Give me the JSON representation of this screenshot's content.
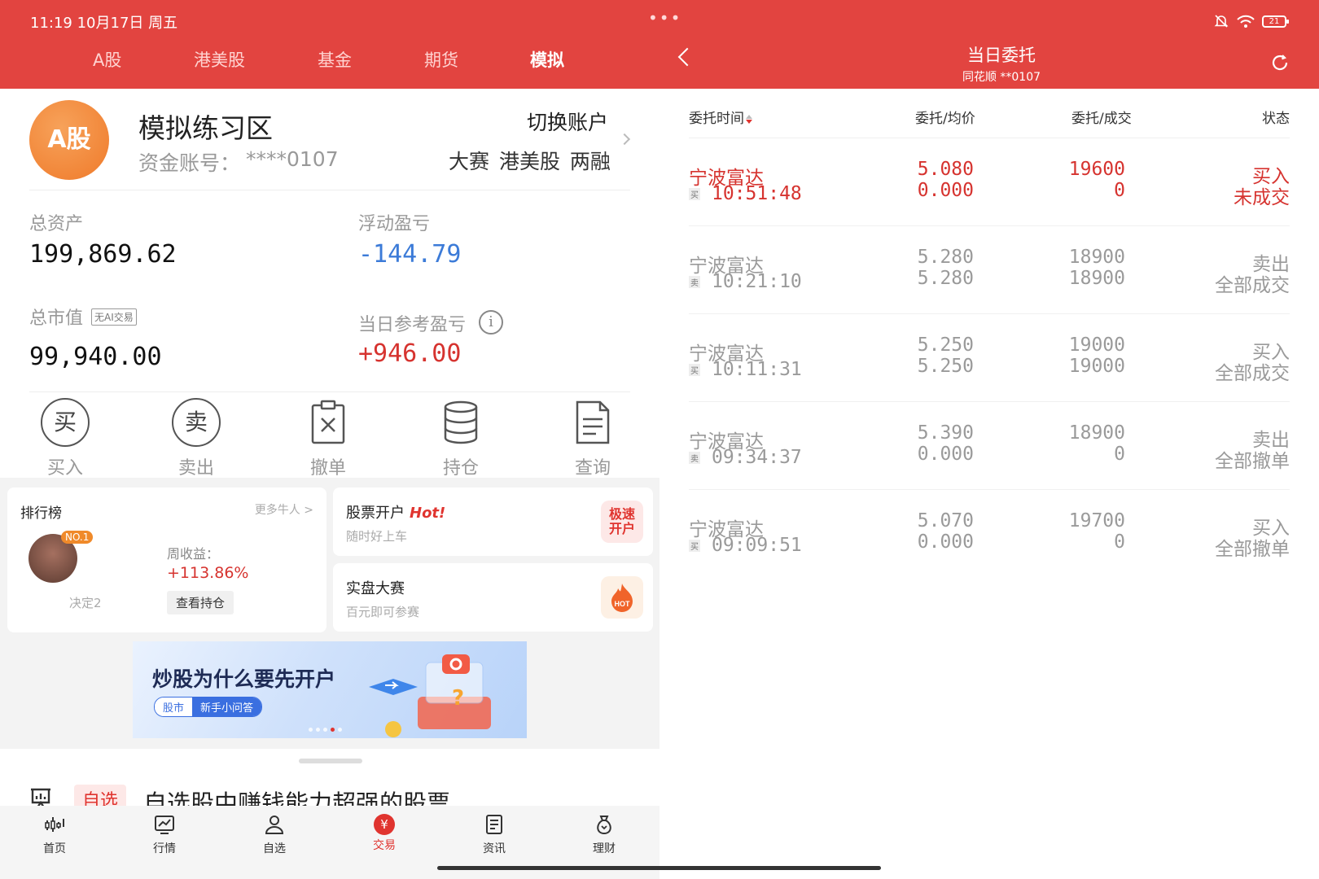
{
  "status": {
    "time": "11:19  10月17日 周五",
    "dots": "•••",
    "battery": "21"
  },
  "market_tabs": [
    {
      "label": "A股"
    },
    {
      "label": "港美股"
    },
    {
      "label": "基金"
    },
    {
      "label": "期货"
    },
    {
      "label": "模拟",
      "active": true
    }
  ],
  "account": {
    "avatar": "A股",
    "title": "模拟练习区",
    "account_no_label": "资金账号：",
    "account_no": "****0107",
    "switch_label": "切换账户",
    "links": "大赛 港美股 两融"
  },
  "stats": {
    "total_assets_label": "总资产",
    "total_assets": "199,869.62",
    "floating_pl_label": "浮动盈亏",
    "floating_pl": "-144.79",
    "market_value_label": "总市值",
    "ai_badge": "无AI交易",
    "market_value": "99,940.00",
    "daily_pl_label": "当日参考盈亏",
    "daily_pl": "+946.00"
  },
  "actions": [
    {
      "label": "买入",
      "glyph": "买",
      "icon": "buy-icon"
    },
    {
      "label": "卖出",
      "glyph": "卖",
      "icon": "sell-icon"
    },
    {
      "label": "撤单",
      "icon": "cancel-order-icon"
    },
    {
      "label": "持仓",
      "icon": "holdings-icon"
    },
    {
      "label": "查询",
      "icon": "query-icon"
    }
  ],
  "ranking": {
    "title": "排行榜",
    "more": "更多牛人 >",
    "badge": "NO.1",
    "name": "决定2",
    "weekly_label": "周收益：",
    "weekly_value": "+113.86%",
    "button": "查看持仓"
  },
  "promos": [
    {
      "title": "股票开户",
      "hot": "Hot!",
      "subtitle": "随时好上车",
      "badge": "极速开户"
    },
    {
      "title": "实盘大赛",
      "subtitle": "百元即可参赛",
      "badge": "HOT"
    }
  ],
  "banner": {
    "title": "炒股为什么要先开户",
    "tag_a": "股市",
    "tag_b": "新手小问答"
  },
  "feed": {
    "tag": "自选",
    "text": "自选股中赚钱能力超强的股票"
  },
  "bottom_nav": [
    {
      "label": "首页",
      "icon": "home-chart-icon"
    },
    {
      "label": "行情",
      "icon": "market-icon"
    },
    {
      "label": "自选",
      "icon": "watchlist-icon"
    },
    {
      "label": "交易",
      "icon": "trade-yuan-icon",
      "active": true,
      "glyph": "¥"
    },
    {
      "label": "资讯",
      "icon": "news-icon"
    },
    {
      "label": "理财",
      "icon": "wealth-icon"
    }
  ],
  "detail": {
    "title": "当日委托",
    "subtitle": "同花顺 **0107",
    "columns": [
      "委托时间",
      "委托/均价",
      "委托/成交",
      "状态"
    ],
    "orders": [
      {
        "name": "宁波富达",
        "side": "买",
        "time": "10:51:48",
        "price": "5.080",
        "avg": "0.000",
        "qty": "19600",
        "filled": "0",
        "action": "买入",
        "status": "未成交",
        "highlight": true
      },
      {
        "name": "宁波富达",
        "side": "卖",
        "time": "10:21:10",
        "price": "5.280",
        "avg": "5.280",
        "qty": "18900",
        "filled": "18900",
        "action": "卖出",
        "status": "全部成交"
      },
      {
        "name": "宁波富达",
        "side": "买",
        "time": "10:11:31",
        "price": "5.250",
        "avg": "5.250",
        "qty": "19000",
        "filled": "19000",
        "action": "买入",
        "status": "全部成交"
      },
      {
        "name": "宁波富达",
        "side": "卖",
        "time": "09:34:37",
        "price": "5.390",
        "avg": "0.000",
        "qty": "18900",
        "filled": "0",
        "action": "卖出",
        "status": "全部撤单"
      },
      {
        "name": "宁波富达",
        "side": "买",
        "time": "09:09:51",
        "price": "5.070",
        "avg": "0.000",
        "qty": "19700",
        "filled": "0",
        "action": "买入",
        "status": "全部撤单"
      }
    ]
  }
}
